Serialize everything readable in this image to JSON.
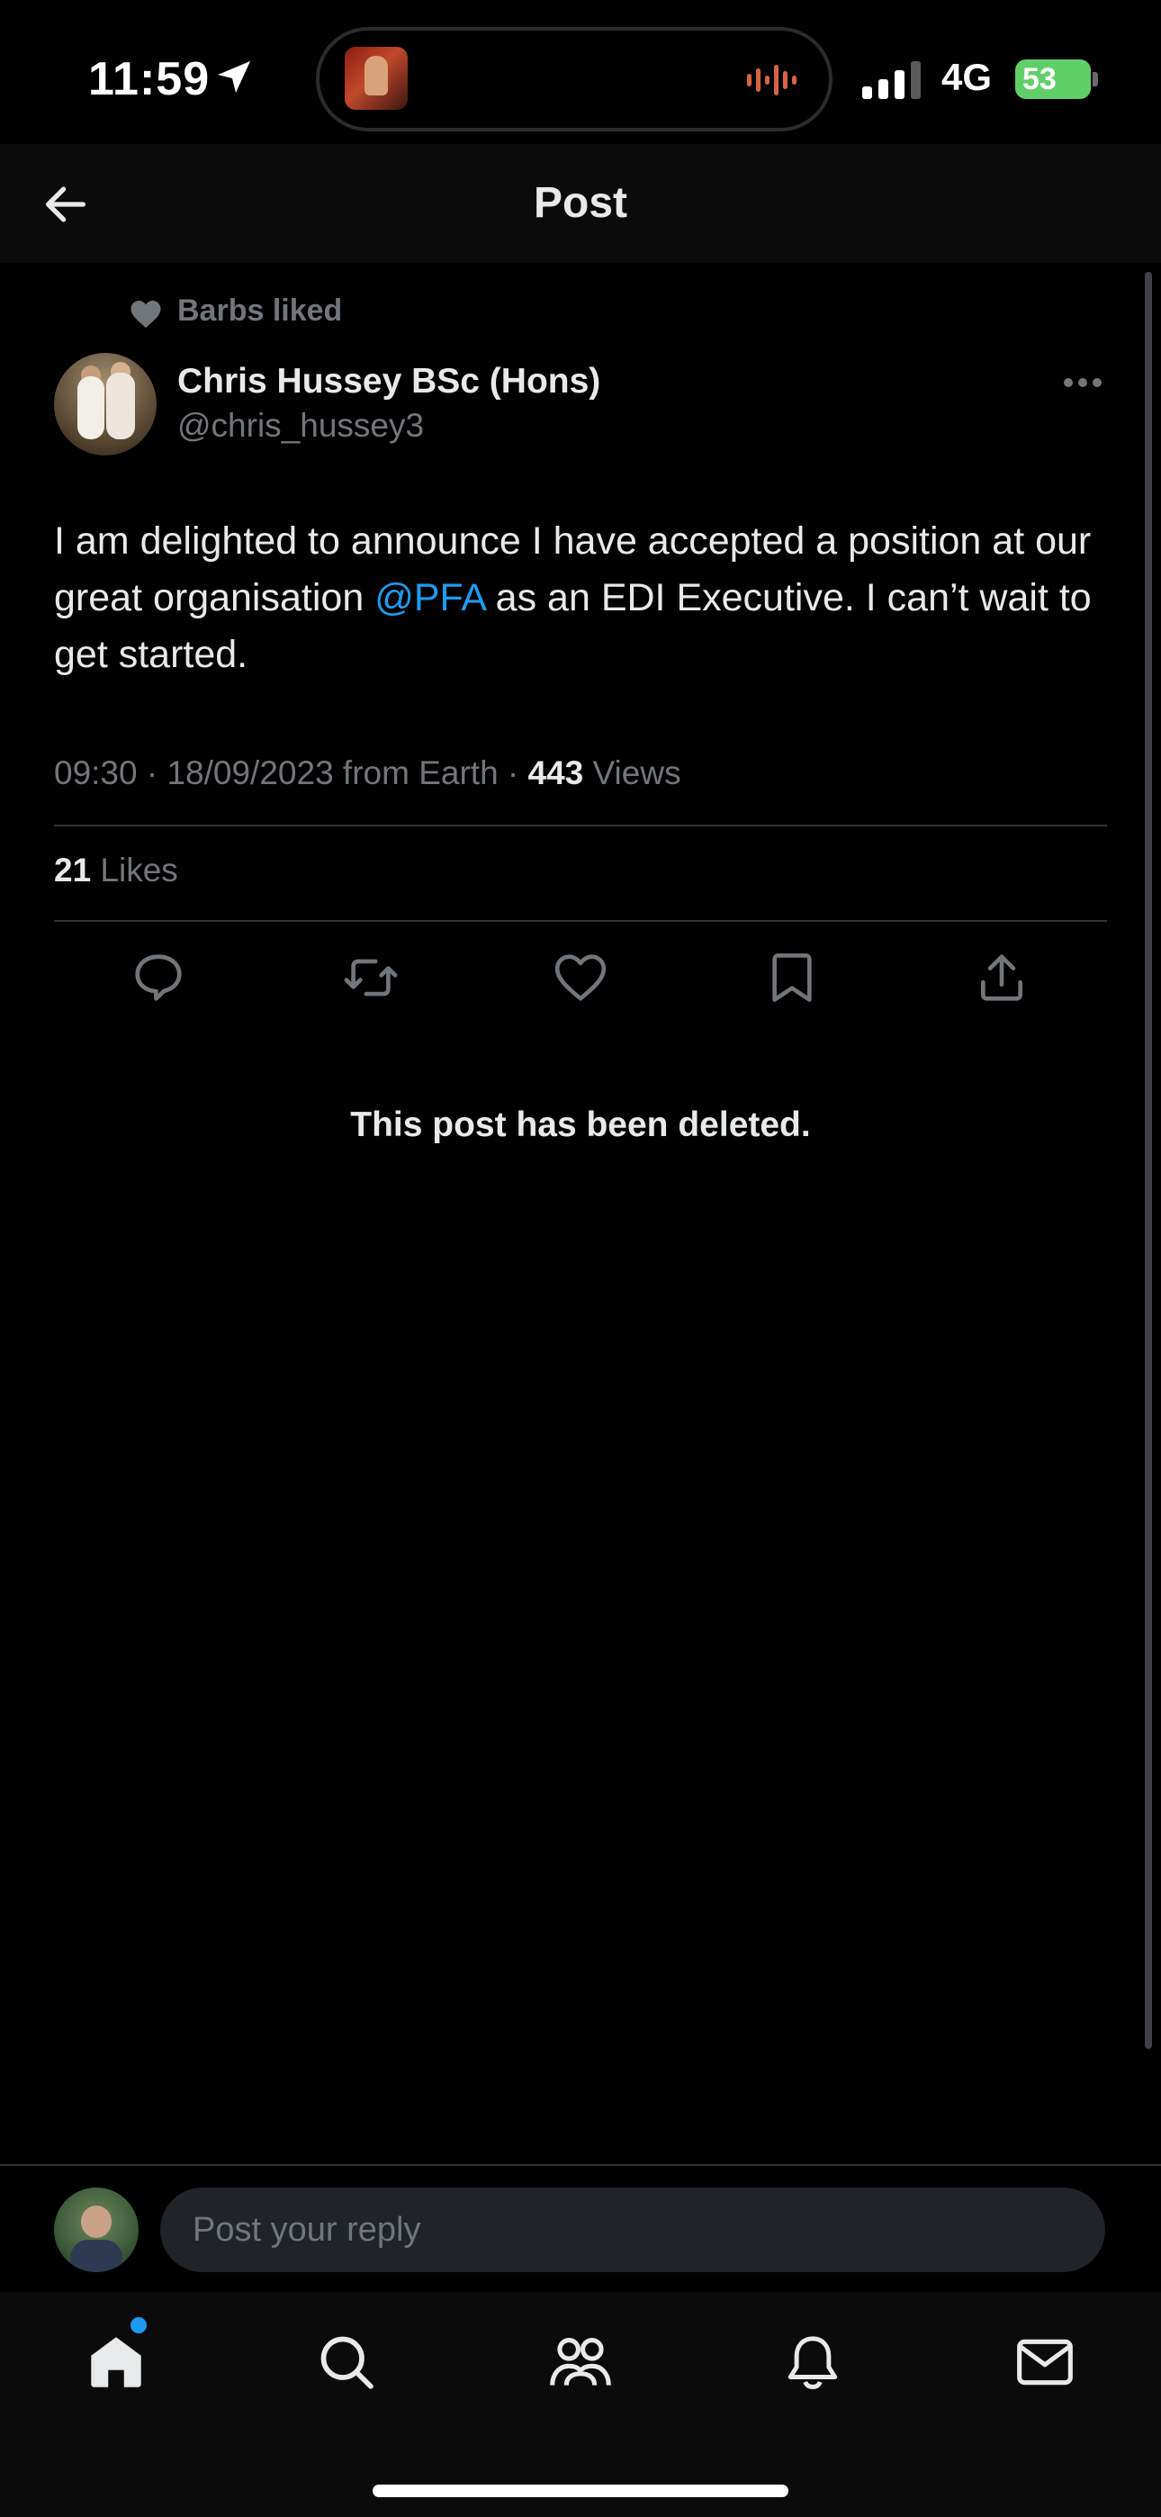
{
  "status_bar": {
    "time": "11:59",
    "network": "4G",
    "battery": "53"
  },
  "header": {
    "title": "Post"
  },
  "post": {
    "social_context": "Barbs liked",
    "author_name": "Chris Hussey BSc (Hons)",
    "author_handle": "@chris_hussey3",
    "text_part1": "I am delighted to announce I have accepted a position at our great organisation ",
    "mention": "@PFA",
    "text_part2": " as an EDI Executive. I can’t wait to get started.",
    "meta_prefix": "09:30 · 18/09/2023 from Earth · ",
    "views_count": "443",
    "views_label": " Views",
    "likes_count": "21",
    "likes_label": " Likes",
    "deleted_notice": "This post has been deleted."
  },
  "reply": {
    "placeholder": "Post your reply"
  },
  "icons": {
    "back": "arrow-left-icon",
    "more": "ellipsis-icon",
    "actions": [
      "reply-icon",
      "repost-icon",
      "like-icon",
      "bookmark-icon",
      "share-icon"
    ],
    "tabs": [
      "home-icon",
      "search-icon",
      "communities-icon",
      "notifications-icon",
      "messages-icon"
    ]
  },
  "colors": {
    "accent": "#1d9bf0",
    "muted": "#71767b",
    "battery": "#5fd068"
  }
}
